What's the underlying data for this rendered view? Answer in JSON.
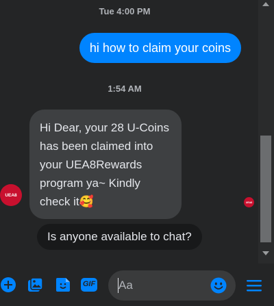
{
  "conversation": {
    "timestamp_1": "Tue 4:00 PM",
    "outgoing_message": "hi how to claim your coins",
    "timestamp_2": "1:54 AM",
    "incoming_message": "Hi Dear, your 28 U-Coins has been claimed into your UEA8Rewards program ya~ Kindly check it🥰",
    "avatar_text": "UEA8",
    "seen_avatar_text": "UEA8",
    "suggested_reply": "Is anyone available to chat?"
  },
  "composer": {
    "placeholder": "Aa",
    "gif_label": "GIF",
    "icons": [
      "plus-icon",
      "photo-icon",
      "sticker-icon",
      "gif-icon",
      "emoji-icon",
      "menu-icon"
    ]
  },
  "colors": {
    "background": "#242526",
    "outgoing_bubble": "#0084ff",
    "incoming_bubble": "#3e4042",
    "accent": "#0084ff",
    "brand": "#c8102e"
  }
}
